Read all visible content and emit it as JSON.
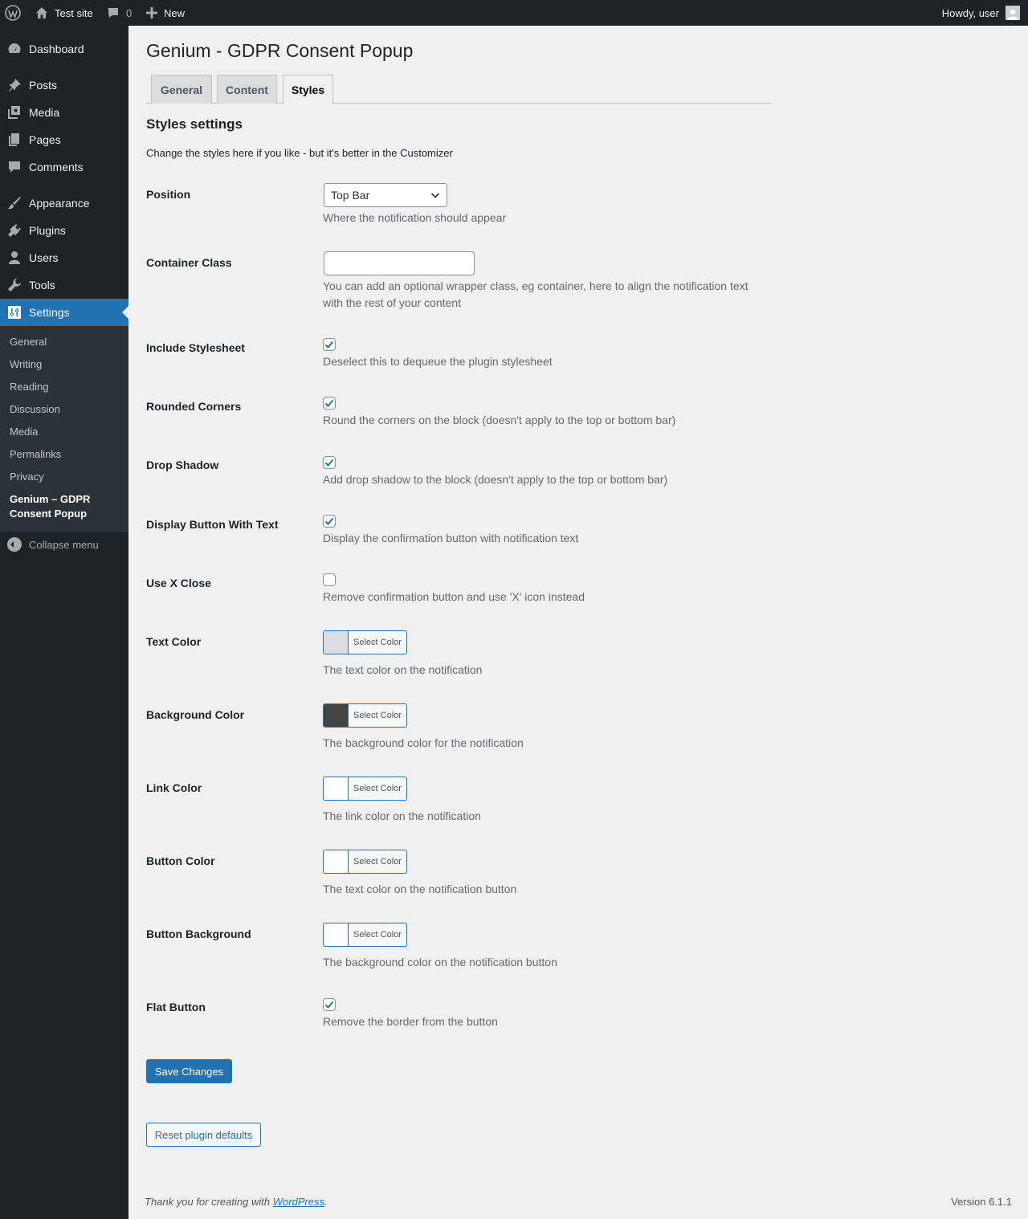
{
  "adminbar": {
    "site_name": "Test site",
    "comments_count": "0",
    "new_label": "New",
    "howdy": "Howdy, user"
  },
  "sidebar": {
    "items": [
      {
        "label": "Dashboard",
        "icon": "dashboard-icon"
      },
      {
        "label": "Posts",
        "icon": "pin-icon"
      },
      {
        "label": "Media",
        "icon": "media-icon"
      },
      {
        "label": "Pages",
        "icon": "pages-icon"
      },
      {
        "label": "Comments",
        "icon": "comment-icon"
      },
      {
        "label": "Appearance",
        "icon": "brush-icon"
      },
      {
        "label": "Plugins",
        "icon": "plug-icon"
      },
      {
        "label": "Users",
        "icon": "user-icon"
      },
      {
        "label": "Tools",
        "icon": "wrench-icon"
      },
      {
        "label": "Settings",
        "icon": "settings-icon"
      }
    ],
    "submenu": [
      "General",
      "Writing",
      "Reading",
      "Discussion",
      "Media",
      "Permalinks",
      "Privacy"
    ],
    "submenu_current_line1": "Genium – GDPR",
    "submenu_current_line2": "Consent Popup",
    "collapse": "Collapse menu"
  },
  "page": {
    "title": "Genium - GDPR Consent Popup",
    "tabs": [
      "General",
      "Content",
      "Styles"
    ],
    "active_tab": "Styles",
    "section_title": "Styles settings",
    "section_desc": "Change the styles here if you like - but it's better in the Customizer"
  },
  "fields": {
    "position": {
      "label": "Position",
      "value": "Top Bar",
      "desc": "Where the notification should appear"
    },
    "container_class": {
      "label": "Container Class",
      "value": "",
      "desc": "You can add an optional wrapper class, eg container, here to align the notification text with the rest of your content"
    },
    "include_stylesheet": {
      "label": "Include Stylesheet",
      "checked": true,
      "desc": "Deselect this to dequeue the plugin stylesheet"
    },
    "rounded_corners": {
      "label": "Rounded Corners",
      "checked": true,
      "desc": "Round the corners on the block (doesn't apply to the top or bottom bar)"
    },
    "drop_shadow": {
      "label": "Drop Shadow",
      "checked": true,
      "desc": "Add drop shadow to the block (doesn't apply to the top or bottom bar)"
    },
    "display_button": {
      "label": "Display Button With Text",
      "checked": true,
      "desc": "Display the confirmation button with notification text"
    },
    "use_x_close": {
      "label": "Use X Close",
      "checked": false,
      "desc": "Remove confirmation button and use 'X' icon instead"
    },
    "text_color": {
      "label": "Text Color",
      "color": "#dddddd",
      "desc": "The text color on the notification"
    },
    "background_color": {
      "label": "Background Color",
      "color": "#444444",
      "desc": "The background color for the notification"
    },
    "link_color": {
      "label": "Link Color",
      "color": "#ffffff",
      "desc": "The link color on the notification"
    },
    "button_color": {
      "label": "Button Color",
      "color": "#ffffff",
      "desc": "The text color on the notification button"
    },
    "button_background": {
      "label": "Button Background",
      "color": "#ffffff",
      "desc": "The background color on the notification button"
    },
    "flat_button": {
      "label": "Flat Button",
      "checked": true,
      "desc": "Remove the border from the button"
    },
    "select_color_label": "Select Color"
  },
  "buttons": {
    "save": "Save Changes",
    "reset": "Reset plugin defaults"
  },
  "footer": {
    "thanks_prefix": "Thank you for creating with ",
    "thanks_link": "WordPress",
    "thanks_suffix": ".",
    "version": "Version 6.1.1"
  },
  "colors": {
    "accent": "#2271b1",
    "adminbar_bg": "#1d2327",
    "submenu_bg": "#2c3338"
  }
}
